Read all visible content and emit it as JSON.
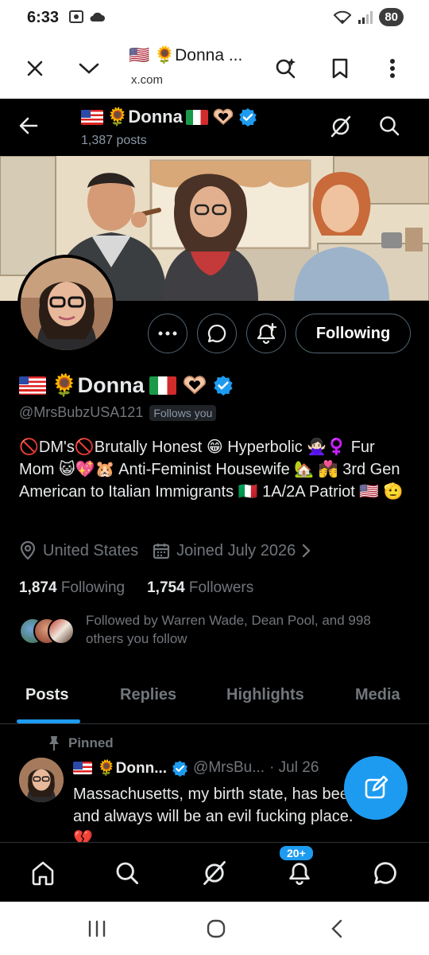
{
  "status_bar": {
    "time": "6:33",
    "battery": "80"
  },
  "browser": {
    "title": "🇺🇸 🌻Donna ...",
    "url": "x.com",
    "icons": [
      "close-icon",
      "chevron-down-icon",
      "sparkle-search-icon",
      "bookmark-icon",
      "more-vertical-icon"
    ]
  },
  "header": {
    "display_name": "🌻Donna",
    "posts_count": "1,387 posts"
  },
  "profile": {
    "display_name": "🌻Donna",
    "handle": "@MrsBubzUSA121",
    "follows_you": "Follows you",
    "bio": "🚫DM's🚫Brutally Honest 😁 Hyperbolic 🙅🏻‍♀️♀️ Fur Mom 😺💖🐹 Anti-Feminist Housewife 🏡 💏 3rd Gen American to Italian Immigrants 🇮🇹 1A/2A Patriot 🇺🇸 🫡",
    "location": "United States",
    "joined": "Joined July 2026",
    "following_count": "1,874",
    "following_label": "Following",
    "followers_count": "1,754",
    "followers_label": "Followers",
    "followed_by": "Followed by Warren Wade, Dean Pool, and 998 others you follow",
    "follow_button": "Following"
  },
  "tabs": [
    {
      "label": "Posts",
      "active": true
    },
    {
      "label": "Replies",
      "active": false
    },
    {
      "label": "Highlights",
      "active": false
    },
    {
      "label": "Media",
      "active": false
    }
  ],
  "pinned_post": {
    "pinned_label": "Pinned",
    "name": "🌻Donn...",
    "handle": "@MrsBu...",
    "date": "· Jul 26",
    "text": "Massachusetts, my birth state, has been and always will be an evil fucking place. 💔"
  },
  "bottom_nav": {
    "notif_badge": "20+",
    "icons": [
      "home-icon",
      "search-icon",
      "grok-icon",
      "notifications-icon",
      "messages-icon"
    ]
  },
  "colors": {
    "accent": "#1d9bf0",
    "background": "#000000",
    "text": "#e7e9ea",
    "muted": "#71767b"
  }
}
